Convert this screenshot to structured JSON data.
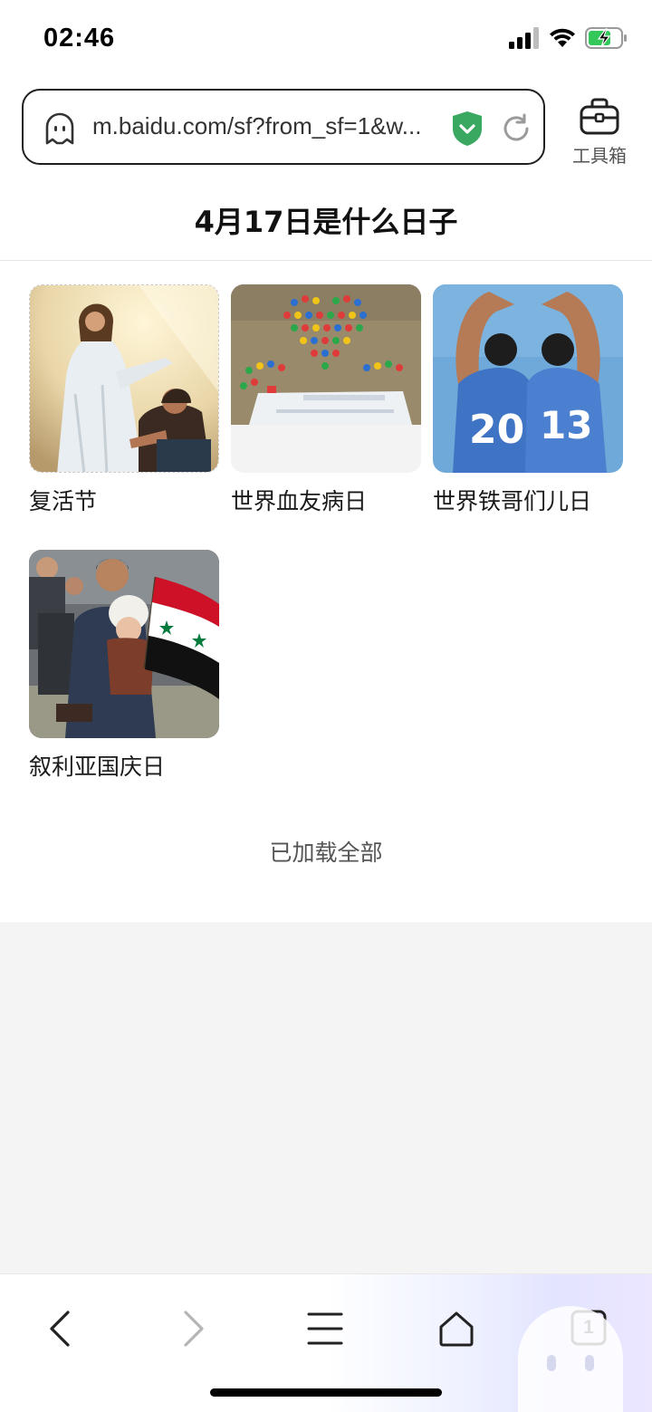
{
  "status_bar": {
    "time": "02:46",
    "icons": [
      "signal-icon",
      "wifi-icon",
      "battery-charging-icon"
    ]
  },
  "address_bar": {
    "url": "m.baidu.com/sf?from_sf=1&w...",
    "icons": [
      "ghost-icon",
      "security-shield-icon",
      "reload-icon"
    ]
  },
  "toolbox": {
    "label": "工具箱",
    "icon": "toolbox-icon"
  },
  "page_title": "4月17日是什么日子",
  "cards": [
    {
      "label": "复活节",
      "image": "easter-image"
    },
    {
      "label": "世界血友病日",
      "image": "world-hemophilia-day-image"
    },
    {
      "label": "世界铁哥们儿日",
      "image": "world-buddies-day-image"
    },
    {
      "label": "叙利亚国庆日",
      "image": "syria-national-day-image"
    }
  ],
  "footer_status": "已加载全部",
  "bottom_nav": {
    "items": [
      "back-icon",
      "forward-icon",
      "menu-icon",
      "home-icon",
      "tabs-icon"
    ],
    "tabs_count": "1"
  },
  "colors": {
    "shield_green": "#3aa860",
    "text_primary": "#1a1a1a",
    "gray_background": "#f4f4f4"
  }
}
